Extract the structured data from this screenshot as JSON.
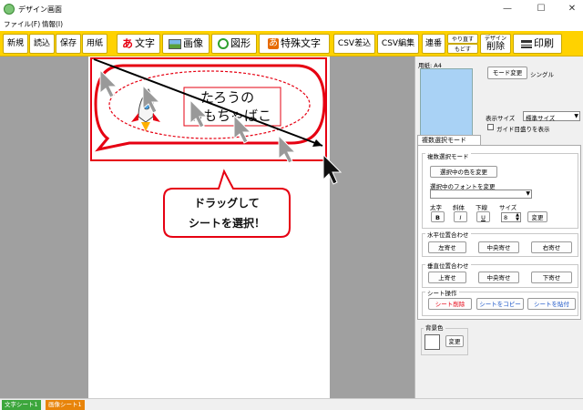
{
  "window": {
    "title": "デザイン画面"
  },
  "menu": {
    "file": "ファイル(F)",
    "info": "情報(I)"
  },
  "toolbar": {
    "new": "新規",
    "load": "読込",
    "save": "保存",
    "paper": "用紙",
    "text": "文字",
    "image": "画像",
    "shape": "図形",
    "special": "特殊文字",
    "csv_import": "CSV差込",
    "csv_edit": "CSV編集",
    "connect": "連番",
    "undo": "やり直す",
    "redo": "もどす",
    "design": "デザイン",
    "delete": "削除",
    "print": "印刷"
  },
  "canvas": {
    "text_line1": "たろうの",
    "text_line2": "おもちゃばこ",
    "callout": "ドラッグして\nシートを選択！"
  },
  "panel": {
    "paper_label": "用紙: A4",
    "mode_change": "モード変更",
    "single": "シングル",
    "display_size_label": "表示サイズ",
    "display_size_value": "標準サイズ",
    "guide_checkbox": "ガイド目盛りを表示",
    "multi_select_tab": "複数選択モード",
    "multi_select_group": "複数選択モード",
    "change_color_btn": "選択中の色を変更",
    "change_font_label": "選択中のフォントを変更",
    "bold_label": "太字",
    "italic_label": "斜体",
    "underline_label": "下線",
    "size_label": "サイズ",
    "bold_btn": "B",
    "italic_btn": "I",
    "underline_btn": "U",
    "size_value": "8",
    "apply_btn": "変更",
    "h_align_group": "水平位置合わせ",
    "left_btn": "左寄せ",
    "hcenter_btn": "中央寄せ",
    "right_btn": "右寄せ",
    "v_align_group": "垂直位置合わせ",
    "top_btn": "上寄せ",
    "vcenter_btn": "中央寄せ",
    "bottom_btn": "下寄せ",
    "sheet_ops_group": "シート操作",
    "delete_sheet_btn": "シート削除",
    "copy_sheet_btn": "シートをコピー",
    "paste_sheet_btn": "シートを貼付",
    "bg_color_group": "背景色",
    "bg_change_btn": "変更"
  },
  "status": {
    "tab_text": "文字シート1",
    "tab_image": "画像シート1"
  },
  "colors": {
    "toolbar": "#ffd200",
    "accent_red": "#e60012",
    "paper_preview": "#a9d2f5"
  }
}
